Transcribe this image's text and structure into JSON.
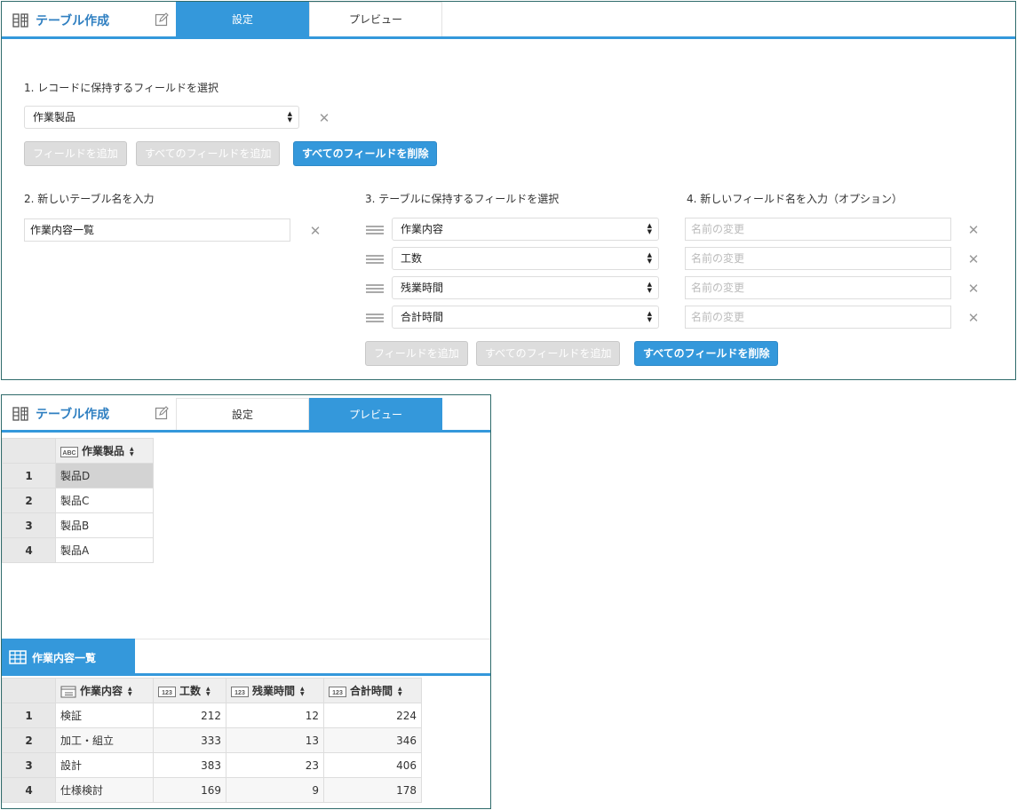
{
  "app": {
    "title": "テーブル作成",
    "tabs": {
      "settings": "設定",
      "preview": "プレビュー"
    }
  },
  "colors": {
    "accent": "#3498db",
    "border": "#2f6b6b"
  },
  "step1": {
    "label": "1. レコードに保持するフィールドを選択",
    "field": "作業製品",
    "buttons": {
      "add": "フィールドを追加",
      "add_all": "すべてのフィールドを追加",
      "remove_all": "すべてのフィールドを削除"
    }
  },
  "step2": {
    "label": "2. 新しいテーブル名を入力",
    "value": "作業内容一覧"
  },
  "step3": {
    "label": "3. テーブルに保持するフィールドを選択",
    "fields": [
      "作業内容",
      "工数",
      "残業時間",
      "合計時間"
    ],
    "buttons": {
      "add": "フィールドを追加",
      "add_all": "すべてのフィールドを追加",
      "remove_all": "すべてのフィールドを削除"
    }
  },
  "step4": {
    "label": "4. 新しいフィールド名を入力（オプション）",
    "placeholder": "名前の変更"
  },
  "preview": {
    "record_table": {
      "header": "作業製品",
      "header_type": "ABC",
      "rows": [
        {
          "n": "1",
          "v": "製品D"
        },
        {
          "n": "2",
          "v": "製品C"
        },
        {
          "n": "3",
          "v": "製品B"
        },
        {
          "n": "4",
          "v": "製品A"
        }
      ]
    },
    "new_table": {
      "name": "作業内容一覧",
      "headers": [
        "作業内容",
        "工数",
        "残業時間",
        "合計時間"
      ],
      "num_type": "123",
      "rows": [
        {
          "n": "1",
          "c1": "検証",
          "c2": "212",
          "c3": "12",
          "c4": "224"
        },
        {
          "n": "2",
          "c1": "加工・組立",
          "c2": "333",
          "c3": "13",
          "c4": "346"
        },
        {
          "n": "3",
          "c1": "設計",
          "c2": "383",
          "c3": "23",
          "c4": "406"
        },
        {
          "n": "4",
          "c1": "仕様検討",
          "c2": "169",
          "c3": "9",
          "c4": "178"
        }
      ]
    }
  }
}
